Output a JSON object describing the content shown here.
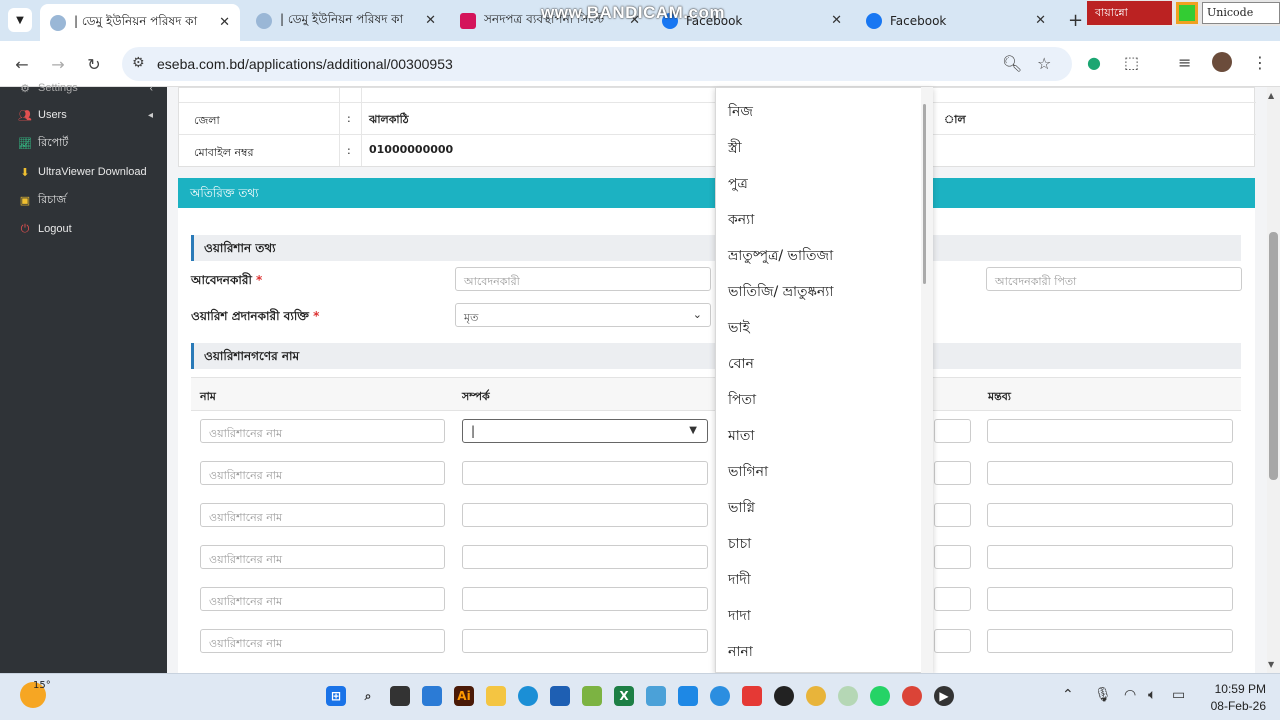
{
  "browser": {
    "tabs": [
      {
        "title": "| ডেমু ইউনিয়ন পরিষদ কা",
        "active": true
      },
      {
        "title": "| ডেমু ইউনিয়ন পরিষদ কা",
        "active": false
      },
      {
        "title": "সনদপত্র ব্যবস্থাপনা সিস্টে",
        "active": false
      },
      {
        "title": "Facebook",
        "active": false
      },
      {
        "title": "Facebook",
        "active": false
      }
    ],
    "url": "eseba.com.bd/applications/additional/00300953",
    "watermark": "www.BANDICAM.com",
    "ext_bijoy": "বায়ান্নো",
    "ext_unicode": "Unicode"
  },
  "sidebar": {
    "items": [
      {
        "label": "Settings",
        "icon": "settings-icon",
        "chevron": true
      },
      {
        "label": "Users",
        "icon": "users-icon",
        "chevron": true
      },
      {
        "label": "রিপোর্ট",
        "icon": "chart-icon",
        "chevron": false
      },
      {
        "label": "UltraViewer Download",
        "icon": "download-icon",
        "chevron": false
      },
      {
        "label": "রিচার্জ",
        "icon": "money-icon",
        "chevron": false
      },
      {
        "label": "Logout",
        "icon": "power-icon",
        "chevron": false
      }
    ]
  },
  "info": {
    "rows": [
      {
        "label": "জেলা",
        "sep": ":",
        "value": "ঝালকাঠি",
        "right": "াল"
      },
      {
        "label": "মোবাইল নম্বর",
        "sep": ":",
        "value": "01000000000",
        "right": ""
      }
    ]
  },
  "form": {
    "section_title": "অতিরিক্ত তথ্য",
    "warish_heading": "ওয়ারিশান তথ্য",
    "applicant_label": "আবেদনকারী",
    "applicant_placeholder": "আবেদনকারী",
    "applicant_father_placeholder": "আবেদনকারী পিতা",
    "provider_label": "ওয়ারিশ প্রদানকারী ব্যক্তি",
    "provider_value": "মৃত",
    "heirs_heading": "ওয়ারিশানগণের নাম",
    "columns": {
      "name": "নাম",
      "relation": "সম্পর্ক",
      "remark": "মন্তব্য"
    },
    "heir_name_placeholder": "ওয়ারিশানের নাম",
    "relation_cursor": "|"
  },
  "dropdown": {
    "options": [
      "নিজ",
      "স্ত্রী",
      "পুত্র",
      "কন্যা",
      "ভ্রাতুষ্পুত্র/ ভাতিজা",
      "ভাতিজি/ ভ্রাতুষ্কন্যা",
      "ভাই",
      "বোন",
      "পিতা",
      "মাতা",
      "ভাগিনা",
      "ভাগ্নি",
      "চাচা",
      "দাদী",
      "দাদা",
      "নানা"
    ]
  },
  "taskbar": {
    "temperature": "15°",
    "time": "10:59 PM",
    "date": "08-Feb-26"
  },
  "colors": {
    "teal": "#1cb2c2",
    "sidebar": "#2f3337",
    "accent_border": "#2a7ab8",
    "required": "#dd3333"
  }
}
